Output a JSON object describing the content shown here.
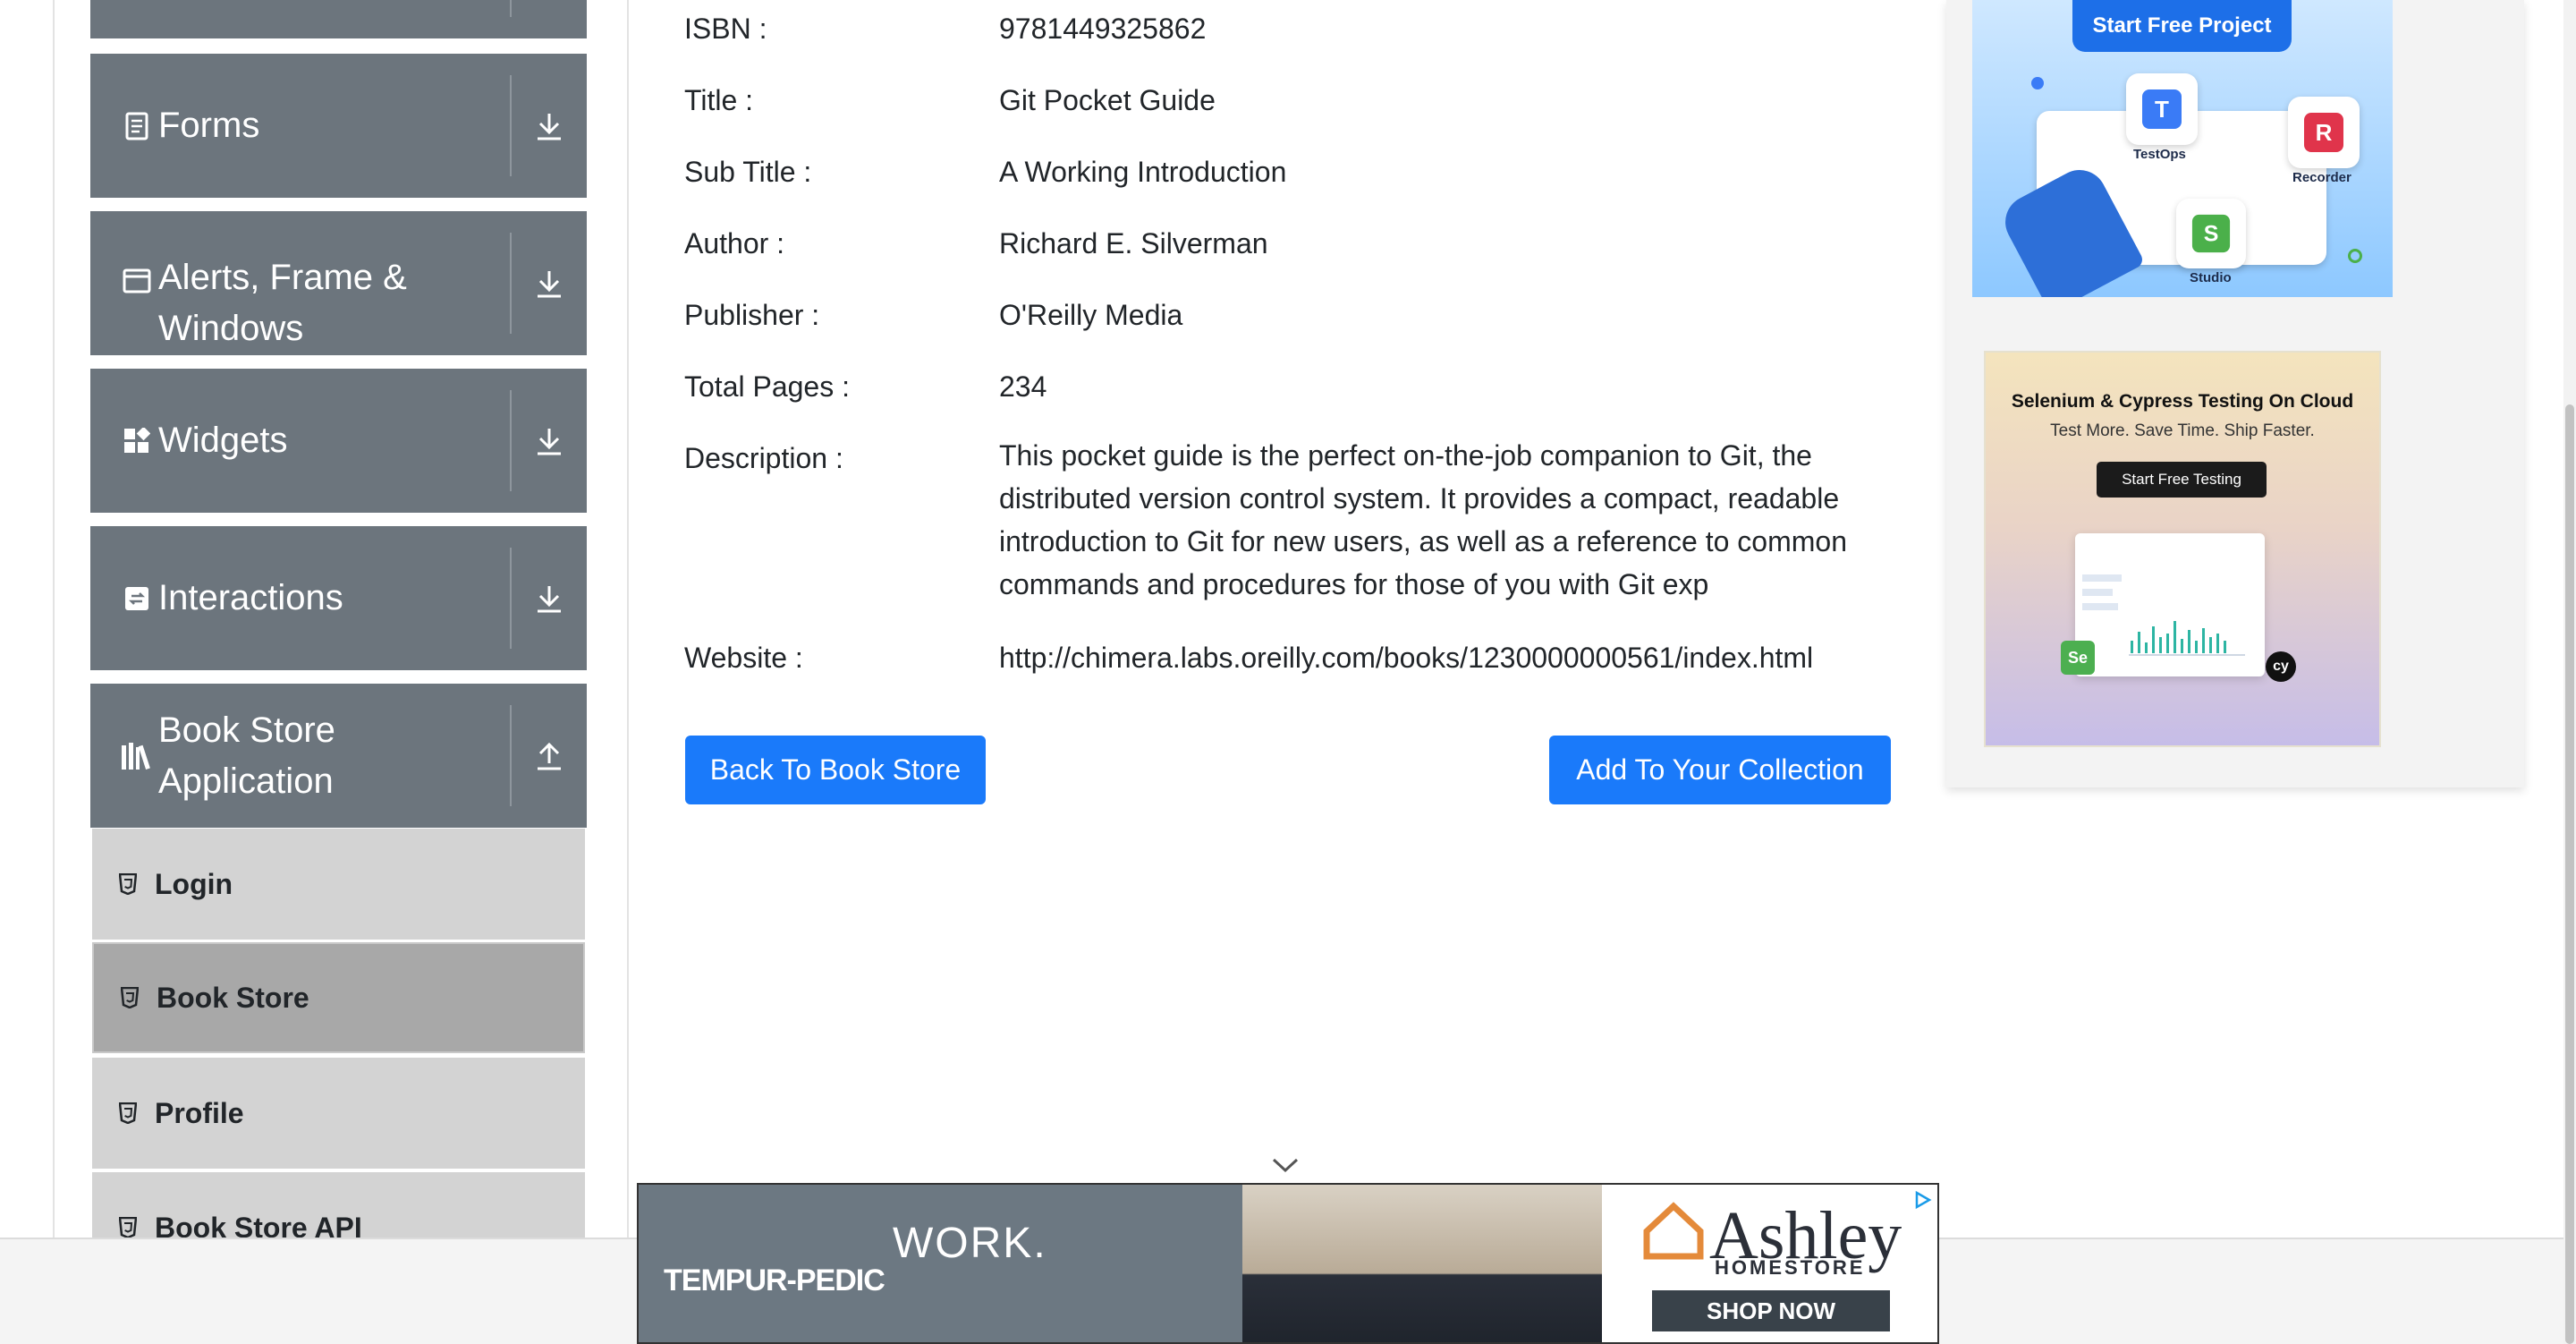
{
  "sidebar": {
    "groups": [
      {
        "label": "",
        "icon": "collapsed-group-icon"
      },
      {
        "label": "Forms",
        "icon": "form-icon"
      },
      {
        "label": "Alerts, Frame & Windows",
        "icon": "window-icon"
      },
      {
        "label": "Widgets",
        "icon": "widgets-icon"
      },
      {
        "label": "Interactions",
        "icon": "interactions-icon"
      },
      {
        "label": "Book Store Application",
        "icon": "books-icon"
      }
    ],
    "book_store_items": [
      {
        "label": "Login",
        "active": false
      },
      {
        "label": "Book Store",
        "active": true
      },
      {
        "label": "Profile",
        "active": false
      },
      {
        "label": "Book Store API",
        "active": false
      }
    ]
  },
  "book": {
    "isbn_label": "ISBN :",
    "isbn": "9781449325862",
    "title_label": "Title :",
    "title": "Git Pocket Guide",
    "subtitle_label": "Sub Title :",
    "subtitle": "A Working Introduction",
    "author_label": "Author :",
    "author": "Richard E. Silverman",
    "publisher_label": "Publisher :",
    "publisher": "O'Reilly Media",
    "pages_label": "Total Pages :",
    "pages": "234",
    "description_label": "Description :",
    "description": "This pocket guide is the perfect on-the-job companion to Git, the distributed version control system. It provides a compact, readable introduction to Git for new users, as well as a reference to common commands and procedures for those of you with Git exp",
    "website_label": "Website :",
    "website": "http://chimera.labs.oreilly.com/books/1230000000561/index.html"
  },
  "actions": {
    "back_label": "Back To Book Store",
    "add_label": "Add To Your Collection"
  },
  "ads": {
    "katalon": {
      "button": "Start Free Project",
      "labels": [
        "TestOps",
        "Recorder",
        "Studio"
      ]
    },
    "lambdatest": {
      "title": "Selenium & Cypress Testing On Cloud",
      "subtitle": "Test More. Save Time. Ship Faster.",
      "button": "Start Free Testing"
    },
    "bottom": {
      "brand_left": "TEMPUR-PEDIC",
      "tagline": "WORK.",
      "brand_right": "Ashley",
      "brand_right_sub": "HOMESTORE",
      "cta": "SHOP NOW"
    }
  },
  "colors": {
    "sidebar_header": "#6c757d",
    "sidebar_item": "#d3d3d3",
    "sidebar_item_active": "#a8a8a8",
    "primary_button": "#1a7afa",
    "link": "#1a73e8"
  }
}
